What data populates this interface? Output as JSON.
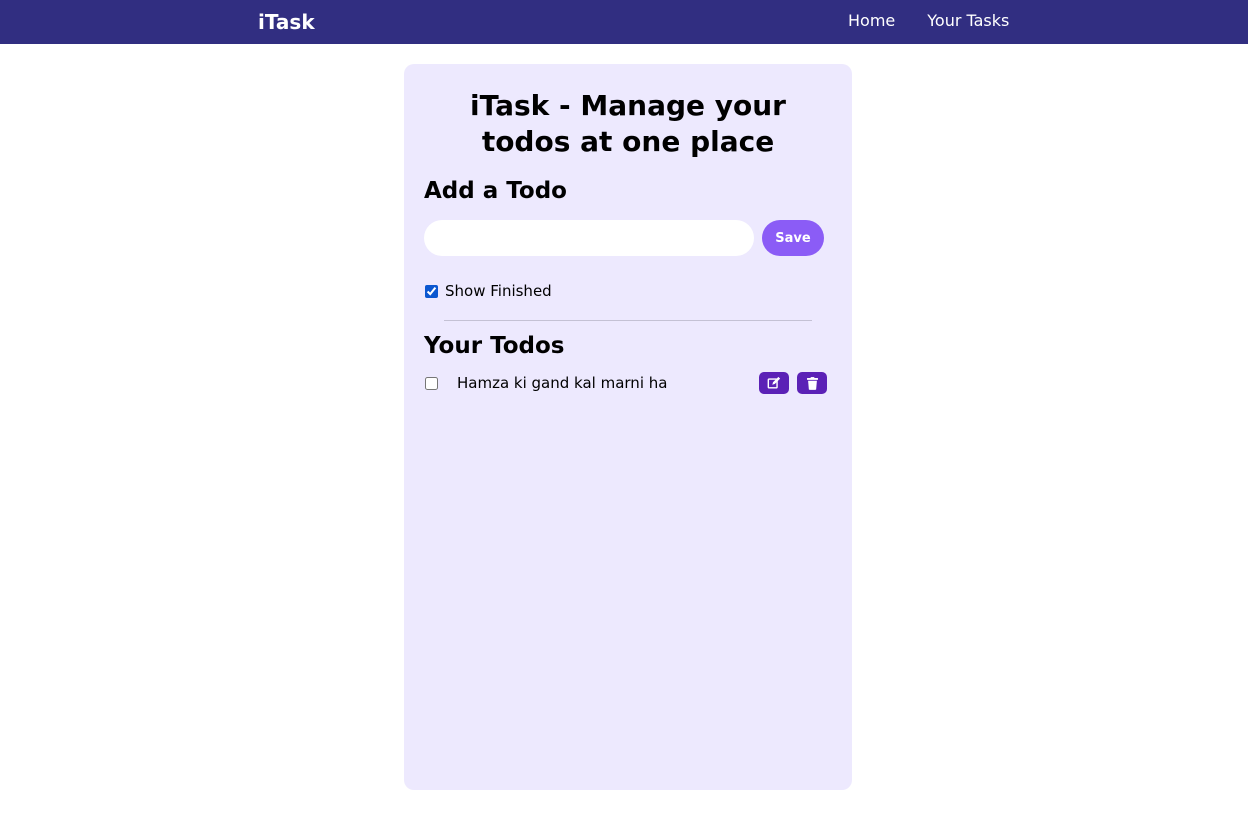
{
  "nav": {
    "brand": "iTask",
    "links": [
      "Home",
      "Your Tasks"
    ]
  },
  "page": {
    "title": "iTask - Manage your todos at one place",
    "add_section_title": "Add a Todo",
    "todo_input_value": "",
    "save_label": "Save",
    "show_finished_label": "Show Finished",
    "show_finished_checked": true,
    "todos_section_title": "Your Todos"
  },
  "todos": [
    {
      "text": "Hamza ki gand kal marni ha",
      "done": false
    }
  ],
  "icons": {
    "edit": "edit-icon",
    "delete": "trash-icon"
  },
  "colors": {
    "navbar": "#312e81",
    "card": "#ede9fe",
    "save_button": "#8b5cf6",
    "action_button": "#5b21b6"
  }
}
